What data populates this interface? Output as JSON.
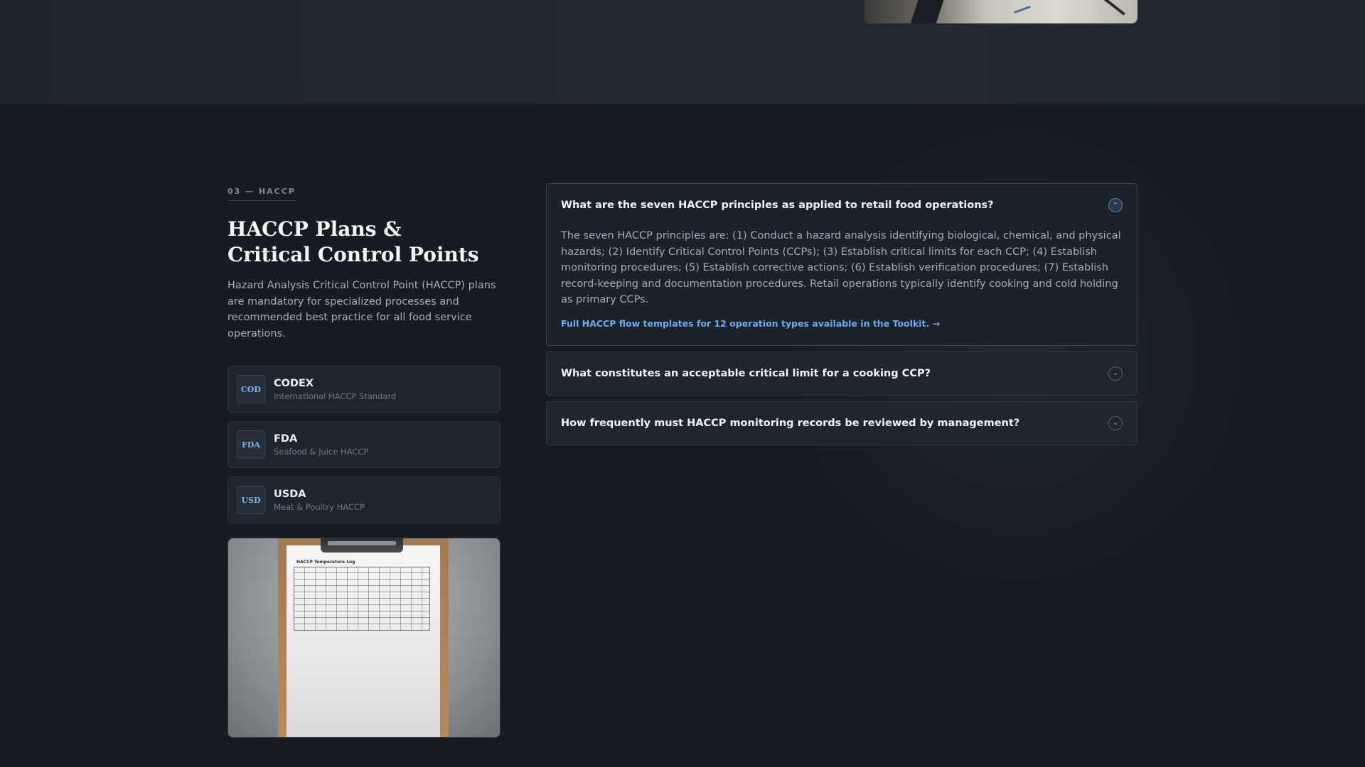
{
  "section": {
    "eyebrow": "03 — HACCP",
    "title": "HACCP Plans & Critical Control Points",
    "intro": "Hazard Analysis Critical Control Point (HACCP) plans are mandatory for specialized processes and recommended best practice for all food service operations."
  },
  "standards": [
    {
      "badge": "COD",
      "name": "CODEX",
      "sub": "International HACCP Standard"
    },
    {
      "badge": "FDA",
      "name": "FDA",
      "sub": "Seafood & Juice HACCP"
    },
    {
      "badge": "USD",
      "name": "USDA",
      "sub": "Meat & Poultry HACCP"
    }
  ],
  "photo": {
    "log_title": "HACCP Temperature Log"
  },
  "faq": [
    {
      "question": "What are the seven HACCP principles as applied to retail food operations?",
      "answer": "The seven HACCP principles are: (1) Conduct a hazard analysis identifying biological, chemical, and physical hazards; (2) Identify Critical Control Points (CCPs); (3) Establish critical limits for each CCP; (4) Establish monitoring procedures; (5) Establish corrective actions; (6) Establish verification procedures; (7) Establish record-keeping and documentation procedures. Retail operations typically identify cooking and cold holding as primary CCPs.",
      "link": "Full HACCP flow templates for 12 operation types available in the Toolkit. →",
      "open": true
    },
    {
      "question": "What constitutes an acceptable critical limit for a cooking CCP?",
      "open": false
    },
    {
      "question": "How frequently must HACCP monitoring records be reviewed by management?",
      "open": false
    }
  ],
  "icons": {
    "chevron_up": "chevron-up-icon",
    "chevron_down": "chevron-down-icon"
  },
  "colors": {
    "accent": "#6faaf0",
    "background": "#171c22"
  }
}
